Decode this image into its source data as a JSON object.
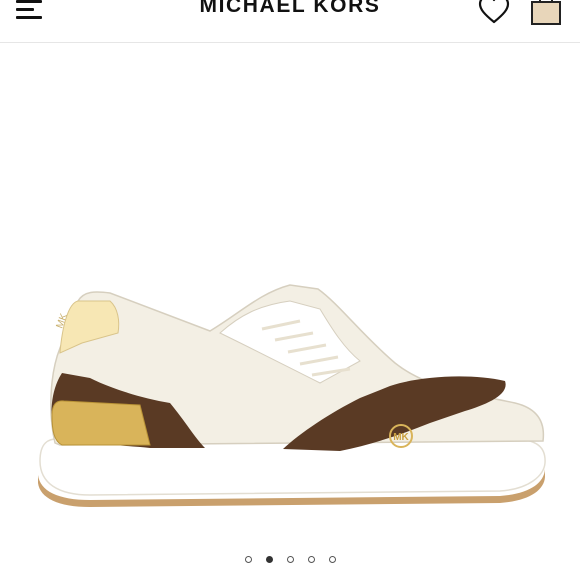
{
  "header": {
    "brand": "MICHAEL KORS",
    "menu_icon": "hamburger-menu-icon",
    "wishlist_icon": "heart-icon",
    "bag_icon": "shopping-bag-icon"
  },
  "product": {
    "image_icon": "sneaker-product-image",
    "heel_logo": "MK",
    "colors": {
      "leather": "#f3efe4",
      "logo_print": "#5a3a24",
      "gold": "#d9b45a",
      "sole": "#ffffff",
      "gum": "#c9a06d"
    }
  },
  "carousel": {
    "total": 5,
    "active_index": 1
  }
}
